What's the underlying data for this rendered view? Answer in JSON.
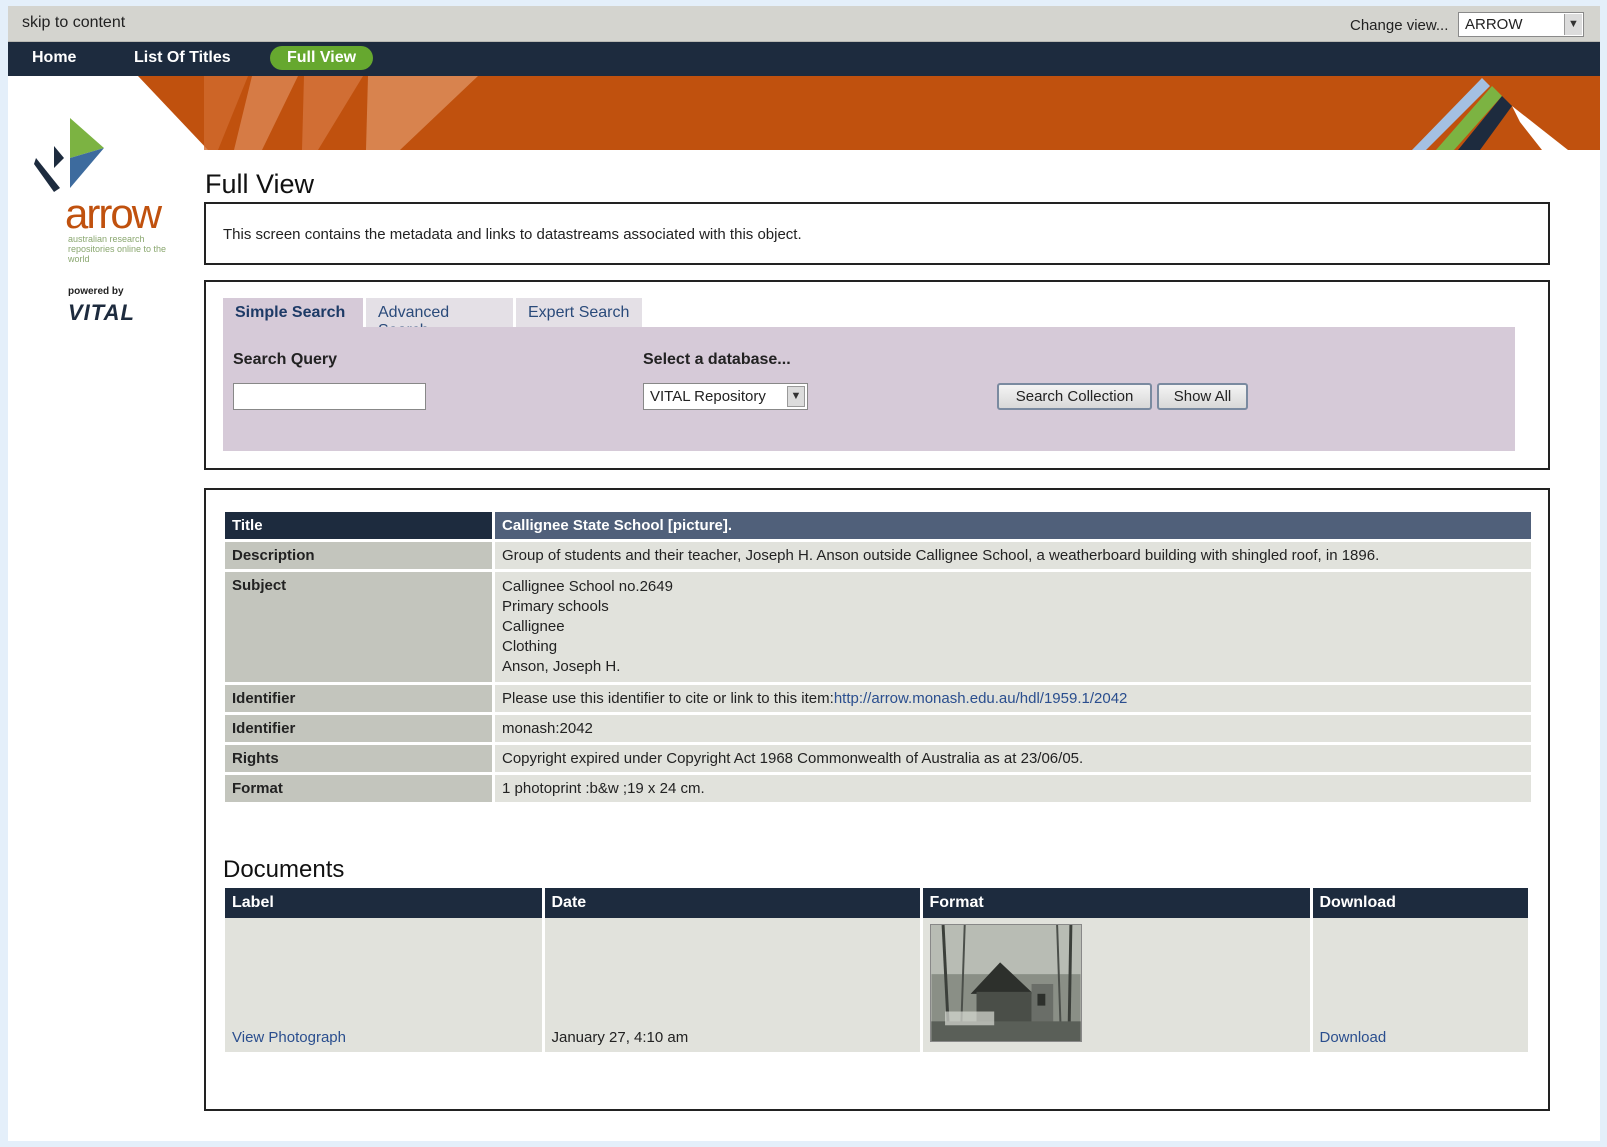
{
  "topbar": {
    "skip_link": "skip to content",
    "change_view_label": "Change view...",
    "view_selected": "ARROW"
  },
  "nav": {
    "items": [
      {
        "label": "Home"
      },
      {
        "label": "List Of Titles"
      },
      {
        "label": "Full View",
        "active": true
      }
    ]
  },
  "logo": {
    "word": "arrow",
    "tagline": "australian research repositories online to the world",
    "powered_by": "powered by",
    "vital": "VITAL"
  },
  "page": {
    "title": "Full View",
    "intro": "This screen contains the metadata and links to datastreams associated with this object."
  },
  "search": {
    "tabs": [
      {
        "label": "Simple Search",
        "active": true
      },
      {
        "label": "Advanced Search"
      },
      {
        "label": "Expert Search"
      }
    ],
    "query_label": "Search Query",
    "query_value": "",
    "db_label": "Select a database...",
    "db_selected": "VITAL Repository",
    "search_button": "Search Collection",
    "show_all_button": "Show All"
  },
  "record": {
    "title_label": "Title",
    "title_value": "Callignee State School [picture].",
    "description_label": "Description",
    "description_value": "Group of students and their teacher, Joseph H. Anson outside Callignee School, a weatherboard building with shingled roof, in 1896.",
    "subject_label": "Subject",
    "subjects": [
      "Callignee School no.2649",
      "Primary schools",
      "Callignee",
      "Clothing",
      "Anson, Joseph H."
    ],
    "identifier1_label": "Identifier",
    "identifier1_prefix": "Please use this identifier to cite or link to this item:",
    "identifier1_link": "http://arrow.monash.edu.au/hdl/1959.1/2042",
    "identifier2_label": "Identifier",
    "identifier2_value": "monash:2042",
    "rights_label": "Rights",
    "rights_value": "Copyright expired under Copyright Act 1968 Commonwealth of Australia as at 23/06/05.",
    "format_label": "Format",
    "format_value": "1 photoprint :b&w ;19 x 24 cm."
  },
  "documents": {
    "title": "Documents",
    "headers": {
      "label": "Label",
      "date": "Date",
      "format": "Format",
      "download": "Download"
    },
    "rows": [
      {
        "label": "View Photograph",
        "date": "January 27, 4:10 am",
        "download": "Download"
      }
    ]
  },
  "colors": {
    "nav_bg": "#1d2b3e",
    "active_tab_green": "#66a82f",
    "banner_orange": "#c0510e",
    "search_panel": "#d6cad8",
    "key_cell": "#c3c5bd",
    "value_cell": "#e1e2dc",
    "title_value_bg": "#50607a",
    "link": "#2a4e8e"
  }
}
